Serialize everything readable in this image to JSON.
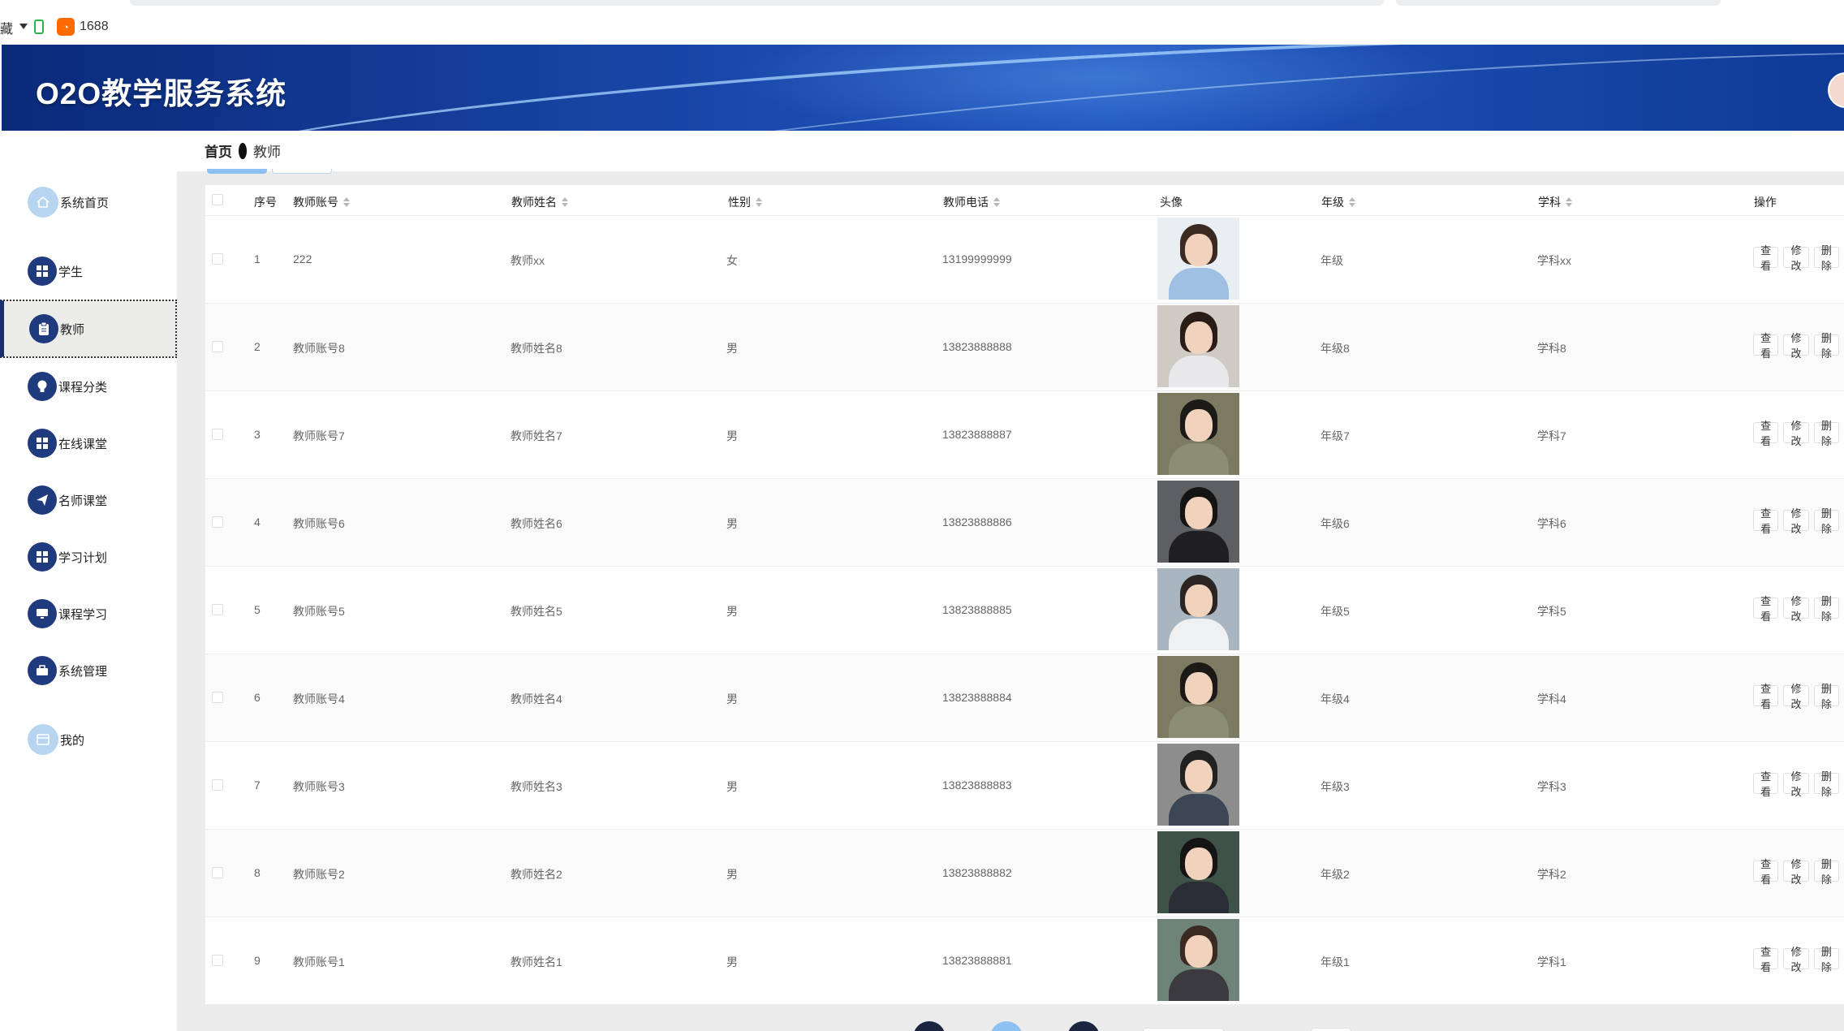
{
  "browser": {
    "bookmarks": [
      {
        "label": "藏",
        "icon": "bookmark-icon"
      },
      {
        "label": "",
        "icon": "phone-icon"
      },
      {
        "label": "1688",
        "icon": "1688-logo-icon"
      }
    ]
  },
  "header": {
    "title": "O2O教学服务系统"
  },
  "breadcrumb": {
    "home": "首页",
    "current": "教师"
  },
  "sidebar": {
    "items": [
      {
        "label": "系统首页",
        "icon": "home-icon"
      },
      {
        "label": "学生",
        "icon": "grid-icon"
      },
      {
        "label": "教师",
        "icon": "clipboard-icon",
        "active": true
      },
      {
        "label": "课程分类",
        "icon": "bulb-icon"
      },
      {
        "label": "在线课堂",
        "icon": "grid-icon"
      },
      {
        "label": "名师课堂",
        "icon": "send-icon"
      },
      {
        "label": "学习计划",
        "icon": "grid-icon"
      },
      {
        "label": "课程学习",
        "icon": "monitor-icon"
      },
      {
        "label": "系统管理",
        "icon": "briefcase-icon"
      },
      {
        "label": "我的",
        "icon": "card-icon"
      }
    ]
  },
  "table": {
    "columns": [
      "序号",
      "教师账号",
      "教师姓名",
      "性别",
      "教师电话",
      "头像",
      "年级",
      "学科",
      "操作"
    ],
    "actions": {
      "view": "查看",
      "edit": "修改",
      "delete": "删除"
    },
    "rows": [
      {
        "index": "1",
        "account": "222",
        "name": "教师xx",
        "gender": "女",
        "phone": "13199999999",
        "grade": "年级",
        "subject": "学科xx"
      },
      {
        "index": "2",
        "account": "教师账号8",
        "name": "教师姓名8",
        "gender": "男",
        "phone": "13823888888",
        "grade": "年级8",
        "subject": "学科8"
      },
      {
        "index": "3",
        "account": "教师账号7",
        "name": "教师姓名7",
        "gender": "男",
        "phone": "13823888887",
        "grade": "年级7",
        "subject": "学科7"
      },
      {
        "index": "4",
        "account": "教师账号6",
        "name": "教师姓名6",
        "gender": "男",
        "phone": "13823888886",
        "grade": "年级6",
        "subject": "学科6"
      },
      {
        "index": "5",
        "account": "教师账号5",
        "name": "教师姓名5",
        "gender": "男",
        "phone": "13823888885",
        "grade": "年级5",
        "subject": "学科5"
      },
      {
        "index": "6",
        "account": "教师账号4",
        "name": "教师姓名4",
        "gender": "男",
        "phone": "13823888884",
        "grade": "年级4",
        "subject": "学科4"
      },
      {
        "index": "7",
        "account": "教师账号3",
        "name": "教师姓名3",
        "gender": "男",
        "phone": "13823888883",
        "grade": "年级3",
        "subject": "学科3"
      },
      {
        "index": "8",
        "account": "教师账号2",
        "name": "教师姓名2",
        "gender": "男",
        "phone": "13823888882",
        "grade": "年级2",
        "subject": "学科2"
      },
      {
        "index": "9",
        "account": "教师账号1",
        "name": "教师姓名1",
        "gender": "男",
        "phone": "13823888881",
        "grade": "年级1",
        "subject": "学科1"
      }
    ]
  },
  "colors": {
    "header": "#1845a6",
    "sidebar_icon": "#1f3a7d",
    "sidebar_icon_light": "#b7d4f0",
    "active_tab": "#8cc1f2",
    "pager_dark": "#1b2540",
    "pager_active": "#8cc1f2"
  }
}
